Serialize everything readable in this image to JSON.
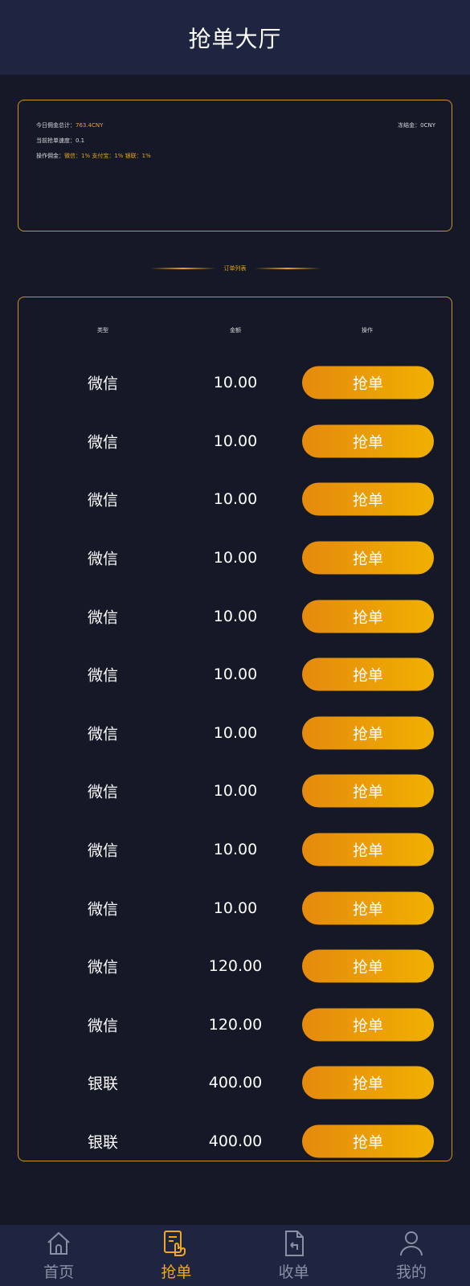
{
  "header": {
    "title": "抢单大厅"
  },
  "info": {
    "commission_label": "今日佣金总计：",
    "commission_value": "763.4CNY",
    "frozen_label": "冻结金：",
    "frozen_value": "0CNY",
    "rate_label": "当前抢单速度：",
    "rate_value": "0.1",
    "fee_label": "操作佣金：",
    "fee_value": "微信：1%  支付宝：1%  银联：1%"
  },
  "section": {
    "label": "订单列表"
  },
  "table": {
    "headers": {
      "type": "类型",
      "amount": "金额",
      "op": "操作"
    },
    "button_label": "抢单",
    "rows": [
      {
        "type": "微信",
        "amount": "10.00"
      },
      {
        "type": "微信",
        "amount": "10.00"
      },
      {
        "type": "微信",
        "amount": "10.00"
      },
      {
        "type": "微信",
        "amount": "10.00"
      },
      {
        "type": "微信",
        "amount": "10.00"
      },
      {
        "type": "微信",
        "amount": "10.00"
      },
      {
        "type": "微信",
        "amount": "10.00"
      },
      {
        "type": "微信",
        "amount": "10.00"
      },
      {
        "type": "微信",
        "amount": "10.00"
      },
      {
        "type": "微信",
        "amount": "10.00"
      },
      {
        "type": "微信",
        "amount": "120.00"
      },
      {
        "type": "微信",
        "amount": "120.00"
      },
      {
        "type": "银联",
        "amount": "400.00"
      },
      {
        "type": "银联",
        "amount": "400.00"
      }
    ]
  },
  "tabbar": {
    "home": "首页",
    "grab": "抢单",
    "receive": "收单",
    "mine": "我的"
  },
  "colors": {
    "accent": "#f0a81c",
    "button_from": "#e58a0e",
    "button_to": "#f0b000",
    "background": "#151827",
    "bar": "#1f2540"
  }
}
